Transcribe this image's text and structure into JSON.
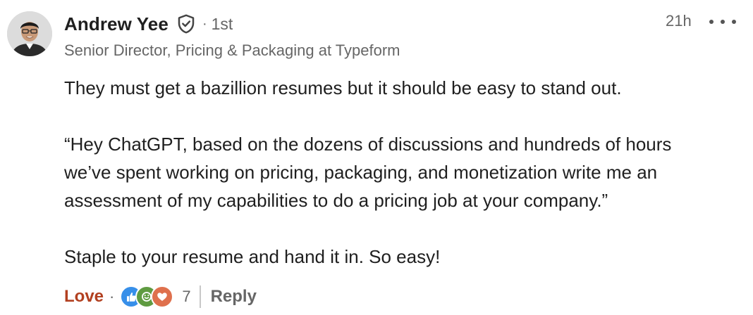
{
  "author": {
    "name": "Andrew Yee",
    "connection_degree": "1st",
    "headline": "Senior Director, Pricing & Packaging at Typeform"
  },
  "comment": {
    "timestamp": "21h",
    "paragraphs": [
      "They must get a bazillion resumes but it should be easy to stand out.",
      "“Hey ChatGPT, based on the dozens of discussions and hundreds of hours",
      "we’ve spent working on pricing, packaging, and monetization write me an",
      "assessment of my capabilities to do a pricing job at your company.”",
      "Staple to your resume and hand it in. So easy!"
    ]
  },
  "footer": {
    "reaction_label": "Love",
    "separator": "·",
    "reaction_count": "7",
    "reply_label": "Reply"
  },
  "icons": {
    "verified": "shield-check-icon",
    "more": "more-options-icon",
    "reactions": [
      "like-icon",
      "insightful-icon",
      "love-icon"
    ]
  },
  "colors": {
    "love_text": "#b24020",
    "like_reaction": "#378fe9",
    "insightful_reaction": "#5f9b41",
    "love_reaction": "#df704d"
  }
}
